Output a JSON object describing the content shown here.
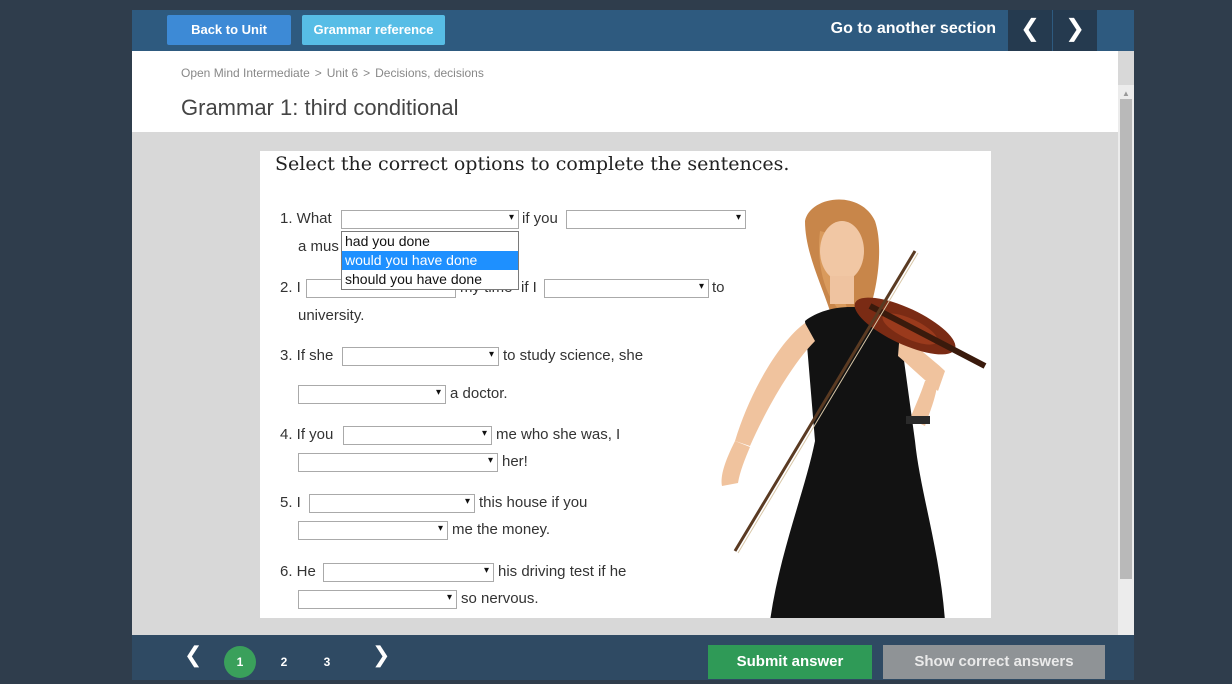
{
  "topbar": {
    "back_label": "Back to Unit",
    "grammar_label": "Grammar reference",
    "goto_label": "Go to another section",
    "prev_icon": "❮",
    "next_icon": "❯"
  },
  "breadcrumb": {
    "items": [
      "Open Mind Intermediate",
      "Unit 6",
      "Decisions, decisions"
    ],
    "separator": ">"
  },
  "page": {
    "title": "Grammar 1: third conditional"
  },
  "exercise": {
    "instruction": "Select the correct options to complete the sentences.",
    "arrow": "▾",
    "q1": {
      "p1": "1. What",
      "p2": "if you",
      "p3": "a mus"
    },
    "q2": {
      "p1": "2. I",
      "p2": "my time",
      "p3": "if I",
      "p4": "to",
      "p5": "university."
    },
    "q3": {
      "p1": "3. If she",
      "p2": "to study science, she",
      "p3": "a doctor."
    },
    "q4": {
      "p1": "4. If you",
      "p2": "me who she was, I",
      "p3": "her!"
    },
    "q5": {
      "p1": "5. I",
      "p2": "this house if you",
      "p3": "me the money."
    },
    "q6": {
      "p1": "6. He",
      "p2": "his driving test if he",
      "p3": "so nervous."
    },
    "dropdown_options": [
      "had you done",
      "would you have done",
      "should you have done"
    ],
    "dropdown_selected": "would you have done"
  },
  "footer": {
    "prev_icon": "❮",
    "next_icon": "❯",
    "pages": [
      "1",
      "2",
      "3"
    ],
    "current_page": "1",
    "submit_label": "Submit answer",
    "show_answers_label": "Show correct answers"
  },
  "colors": {
    "background": "#2f3d4c",
    "topbar": "#2e5a7f",
    "back_button": "#3d8ad6",
    "grammar_button": "#57bde6",
    "submit": "#2f9a57",
    "show_answers": "#8f9396",
    "current_page": "#3aa05b",
    "dropdown_highlight": "#1e90ff"
  },
  "icons": [
    "chevron-left-icon",
    "chevron-right-icon",
    "dropdown-arrow-icon"
  ]
}
